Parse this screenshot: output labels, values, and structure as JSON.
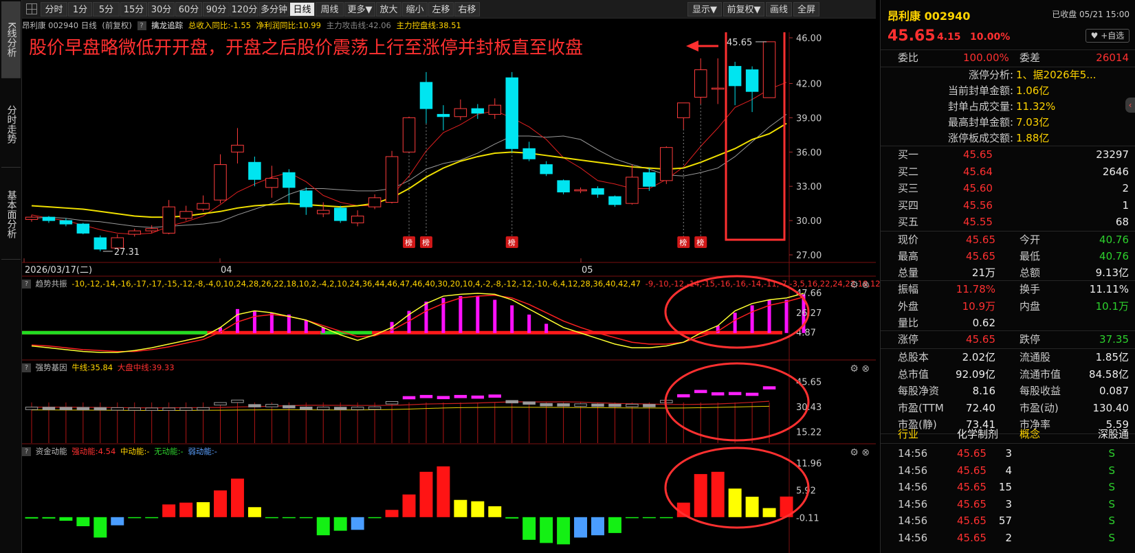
{
  "left_tabs": [
    {
      "label": "K线分析",
      "active": true
    },
    {
      "label": "分时走势",
      "active": false
    },
    {
      "label": "基本面分析",
      "active": false
    }
  ],
  "toolbar": {
    "items": [
      "分时",
      "1分",
      "5分",
      "15分",
      "30分",
      "60分",
      "90分",
      "120分",
      "多分钟",
      "日线",
      "周线",
      "更多▼",
      "放大",
      "缩小",
      "左移",
      "右移"
    ],
    "active": "日线",
    "right_items": [
      "显示▼",
      "前复权▼",
      "画线",
      "全屏"
    ]
  },
  "chart_header": {
    "stock": "昂利康 002940 日线",
    "adjust": "(前复权)",
    "indicator": "擒龙追踪",
    "rev_growth": "总收入同比:-1.55",
    "profit_growth": "净利润同比:10.99",
    "attack_line": "主力攻击线:42.06",
    "control_line": "主力控盘线:38.51"
  },
  "annotation": "股价早盘略微低开开盘，开盘之后股价震荡上行至涨停并封板直至收盘",
  "chart_data": {
    "type": "candlestick",
    "main_y_ticks": [
      "46.00",
      "42.00",
      "39.00",
      "36.00",
      "33.00",
      "30.00",
      "27.00"
    ],
    "x_labels": [
      "2026/03/17(二)",
      "04",
      "05"
    ],
    "low_label": "27.31",
    "high_label": "45.65",
    "bang_label": "榜",
    "candles": [
      {
        "o": 30.1,
        "c": 30.3,
        "h": 30.5,
        "l": 29.9
      },
      {
        "o": 30.3,
        "c": 30.0,
        "h": 30.4,
        "l": 29.8
      },
      {
        "o": 30.0,
        "c": 29.7,
        "h": 30.2,
        "l": 29.5
      },
      {
        "o": 29.7,
        "c": 28.9,
        "h": 29.8,
        "l": 28.8
      },
      {
        "o": 28.5,
        "c": 27.5,
        "h": 28.7,
        "l": 27.31
      },
      {
        "o": 27.6,
        "c": 28.5,
        "h": 28.8,
        "l": 27.5
      },
      {
        "o": 28.8,
        "c": 29.1,
        "h": 29.3,
        "l": 28.6
      },
      {
        "o": 29.1,
        "c": 29.3,
        "h": 29.6,
        "l": 28.9
      },
      {
        "o": 28.9,
        "c": 31.2,
        "h": 31.8,
        "l": 28.8
      },
      {
        "o": 30.2,
        "c": 30.8,
        "h": 31.3,
        "l": 30.0
      },
      {
        "o": 31.0,
        "c": 31.5,
        "h": 32.2,
        "l": 30.8
      },
      {
        "o": 31.8,
        "c": 34.9,
        "h": 35.8,
        "l": 31.5
      },
      {
        "o": 36.0,
        "c": 36.6,
        "h": 38.1,
        "l": 35.0
      },
      {
        "o": 35.1,
        "c": 33.6,
        "h": 35.6,
        "l": 33.0
      },
      {
        "o": 32.9,
        "c": 33.7,
        "h": 34.8,
        "l": 32.0
      },
      {
        "o": 34.2,
        "c": 32.9,
        "h": 34.5,
        "l": 31.5
      },
      {
        "o": 32.6,
        "c": 31.2,
        "h": 32.9,
        "l": 30.5
      },
      {
        "o": 30.6,
        "c": 30.9,
        "h": 31.6,
        "l": 30.3
      },
      {
        "o": 31.1,
        "c": 30.0,
        "h": 31.3,
        "l": 29.8
      },
      {
        "o": 29.8,
        "c": 30.4,
        "h": 30.9,
        "l": 29.5
      },
      {
        "o": 31.2,
        "c": 32.0,
        "h": 32.3,
        "l": 31.0
      },
      {
        "o": 31.6,
        "c": 35.6,
        "h": 36.1,
        "l": 31.5
      },
      {
        "o": 36.0,
        "c": 39.0,
        "h": 39.1,
        "l": 36.0
      },
      {
        "o": 42.1,
        "c": 39.8,
        "h": 43.0,
        "l": 38.5
      },
      {
        "o": 39.3,
        "c": 39.1,
        "h": 40.1,
        "l": 37.9
      },
      {
        "o": 39.1,
        "c": 39.8,
        "h": 40.6,
        "l": 38.8
      },
      {
        "o": 39.8,
        "c": 39.4,
        "h": 40.2,
        "l": 38.9
      },
      {
        "o": 39.3,
        "c": 40.1,
        "h": 40.7,
        "l": 38.9
      },
      {
        "o": 42.5,
        "c": 36.3,
        "h": 43.0,
        "l": 36.0
      },
      {
        "o": 36.3,
        "c": 35.4,
        "h": 36.9,
        "l": 35.2
      },
      {
        "o": 34.9,
        "c": 34.1,
        "h": 35.2,
        "l": 33.9
      },
      {
        "o": 33.5,
        "c": 32.5,
        "h": 33.6,
        "l": 32.3
      },
      {
        "o": 32.6,
        "c": 32.7,
        "h": 32.9,
        "l": 32.4
      },
      {
        "o": 32.8,
        "c": 32.3,
        "h": 33.0,
        "l": 32.0
      },
      {
        "o": 32.1,
        "c": 31.4,
        "h": 32.2,
        "l": 31.2
      },
      {
        "o": 31.5,
        "c": 33.8,
        "h": 34.9,
        "l": 31.4
      },
      {
        "o": 34.2,
        "c": 33.0,
        "h": 34.6,
        "l": 32.6
      },
      {
        "o": 33.5,
        "c": 36.4,
        "h": 36.5,
        "l": 33.2
      },
      {
        "o": 39.0,
        "c": 40.3,
        "h": 40.3,
        "l": 38.0
      },
      {
        "o": 40.8,
        "c": 43.2,
        "h": 44.2,
        "l": 40.2
      },
      {
        "o": 41.5,
        "c": 41.6,
        "h": 44.2,
        "l": 40.2
      },
      {
        "o": 43.5,
        "c": 41.8,
        "h": 43.9,
        "l": 40.1
      },
      {
        "o": 43.2,
        "c": 41.3,
        "h": 43.5,
        "l": 39.5
      },
      {
        "o": 40.76,
        "c": 45.65,
        "h": 45.65,
        "l": 40.76
      }
    ],
    "ma5": [
      30.5,
      30.2,
      30.0,
      29.6,
      29.2,
      28.9,
      28.8,
      28.9,
      29.5,
      29.9,
      30.4,
      31.4,
      32.5,
      33.2,
      33.8,
      34.2,
      33.4,
      32.2,
      31.6,
      31.3,
      31.3,
      32.2,
      33.9,
      36.1,
      37.7,
      38.4,
      39.3,
      39.6,
      39.0,
      38.2,
      37.1,
      35.5,
      34.6,
      33.5,
      33.2,
      32.8,
      32.8,
      33.6,
      34.7,
      36.5,
      38.1,
      39.9,
      40.6,
      41.5,
      42.1
    ],
    "ma10": [
      30.2,
      30.3,
      30.2,
      30.0,
      29.9,
      29.7,
      29.5,
      29.4,
      29.5,
      29.6,
      29.7,
      29.9,
      30.5,
      31.0,
      31.5,
      32.3,
      32.8,
      32.8,
      32.7,
      32.6,
      32.6,
      32.8,
      33.5,
      34.5,
      35.0,
      35.3,
      35.9,
      36.7,
      37.4,
      37.4,
      37.3,
      37.4,
      37.1,
      36.2,
      35.4,
      34.9,
      34.5,
      34.0,
      33.9,
      34.2,
      34.6,
      35.6,
      36.9,
      38.2,
      39.3
    ],
    "ma20": [
      31.3,
      31.2,
      31.1,
      31.0,
      30.8,
      30.6,
      30.4,
      30.3,
      30.3,
      30.4,
      30.6,
      30.8,
      31.1,
      31.3,
      31.4,
      31.5,
      31.4,
      31.3,
      31.2,
      31.3,
      31.5,
      32.0,
      32.8,
      33.8,
      34.6,
      35.2,
      35.6,
      35.9,
      36.0,
      35.9,
      35.7,
      35.5,
      35.3,
      35.1,
      34.9,
      34.7,
      34.6,
      34.5,
      34.6,
      35.1,
      35.7,
      36.3,
      37.1,
      37.6,
      38.5
    ],
    "bang_idx": [
      22,
      23,
      28,
      38,
      39
    ],
    "trend": {
      "title": "趋势共振",
      "out1": [
        -10,
        -12,
        -14,
        -16,
        -17,
        -17,
        -15,
        -12,
        -8,
        -4,
        0,
        10,
        24,
        28,
        26,
        22,
        18,
        10,
        2,
        -4,
        2,
        10,
        24,
        36,
        44,
        46,
        47,
        46,
        40,
        30,
        20,
        10,
        4,
        -2,
        -8,
        -12,
        -12,
        -10,
        -6,
        4,
        12,
        28,
        36,
        40,
        42,
        47
      ],
      "out2": [
        -9,
        -10,
        -12,
        -14,
        -15,
        -16,
        -16,
        -14,
        -11,
        -7,
        -3,
        5,
        16,
        22,
        24,
        22,
        18,
        12,
        6,
        0,
        1,
        7,
        17,
        28,
        36,
        42,
        44,
        45,
        42,
        35,
        26,
        17,
        10,
        4,
        -1,
        -6,
        -8,
        -8,
        -6,
        0,
        6,
        18,
        27,
        34,
        38,
        43
      ],
      "ticks": [
        "47.66",
        "26.27",
        "4.87"
      ],
      "bars": [
        -5,
        -5,
        -5,
        -5,
        -5,
        -5,
        -5,
        -5,
        -5,
        -5,
        -5,
        10,
        30,
        28,
        26,
        24,
        18,
        10,
        -5,
        -5,
        -5,
        16,
        28,
        38,
        42,
        44,
        44,
        40,
        34,
        24,
        14,
        4,
        4,
        4,
        4,
        4,
        4,
        4,
        4,
        4,
        12,
        26,
        34,
        40,
        40,
        46
      ]
    },
    "strong": {
      "title": "强势基因",
      "bull": "牛线:35.84",
      "mid": "大盘中线:39.33",
      "ticks": [
        "45.65",
        "30.43",
        "15.22"
      ]
    },
    "money": {
      "title": "资金动能",
      "strong": "强动能:4.54",
      "mid": "中动能:-",
      "none": "无动能:-",
      "weak": "弱动能:-",
      "ticks": [
        "11.96",
        "5.92",
        "-0.11"
      ],
      "bars": [
        -0.3,
        -0.3,
        -0.8,
        -2.0,
        -4.5,
        -1.8,
        -0.1,
        -0.1,
        2.8,
        3.2,
        3.3,
        5.9,
        8.5,
        2.2,
        -0.2,
        -0.2,
        0.0,
        -4.0,
        -3.0,
        -2.8,
        -0.1,
        1.6,
        5.0,
        10.0,
        11.2,
        3.8,
        3.5,
        2.4,
        -0.3,
        -5.0,
        -5.7,
        -6.0,
        -4.5,
        -4.0,
        -3.5,
        -0.1,
        -0.1,
        -0.1,
        3.2,
        9.5,
        10.0,
        6.3,
        4.5,
        2.0,
        4.54
      ],
      "colors": [
        "g",
        "g",
        "g",
        "g",
        "g",
        "b",
        "g",
        "g",
        "r",
        "r",
        "y",
        "r",
        "r",
        "y",
        "g",
        "g",
        "g",
        "g",
        "g",
        "b",
        "g",
        "r",
        "r",
        "r",
        "r",
        "y",
        "y",
        "y",
        "g",
        "g",
        "g",
        "g",
        "b",
        "b",
        "g",
        "g",
        "g",
        "g",
        "r",
        "r",
        "r",
        "y",
        "y",
        "y",
        "r"
      ]
    }
  },
  "quote": {
    "name": "昂利康 002940",
    "status": "已收盘 05/21 15:00",
    "price": "45.65",
    "change": "4.15",
    "pct": "10.00%",
    "fav": "♥ +自选",
    "webi_label": "委比",
    "webi": "100.00%",
    "weicha_label": "委差",
    "weicha": "26014",
    "limit_analysis": [
      {
        "k": "涨停分析:",
        "v": "1、据2026年5..."
      },
      {
        "k": "当前封单金额:",
        "v": "1.06亿"
      },
      {
        "k": "封单占成交量:",
        "v": "11.32%"
      },
      {
        "k": "最高封单金额:",
        "v": "7.03亿"
      },
      {
        "k": "涨停板成交额:",
        "v": "1.88亿"
      }
    ],
    "buy": [
      {
        "k": "买一",
        "p": "45.65",
        "v": "23297"
      },
      {
        "k": "买二",
        "p": "45.64",
        "v": "2646"
      },
      {
        "k": "买三",
        "p": "45.60",
        "v": "2"
      },
      {
        "k": "买四",
        "p": "45.56",
        "v": "1"
      },
      {
        "k": "买五",
        "p": "45.55",
        "v": "68"
      }
    ],
    "stats1": [
      {
        "k1": "现价",
        "v1": "45.65",
        "c1": "red",
        "k2": "今开",
        "v2": "40.76",
        "c2": "green"
      },
      {
        "k1": "最高",
        "v1": "45.65",
        "c1": "red",
        "k2": "最低",
        "v2": "40.76",
        "c2": "green"
      },
      {
        "k1": "总量",
        "v1": "21万",
        "c1": "white",
        "k2": "总额",
        "v2": "9.13亿",
        "c2": "white"
      }
    ],
    "stats2": [
      {
        "k1": "振幅",
        "v1": "11.78%",
        "c1": "red",
        "k2": "换手",
        "v2": "11.11%",
        "c2": "white"
      },
      {
        "k1": "外盘",
        "v1": "10.9万",
        "c1": "red",
        "k2": "内盘",
        "v2": "10.1万",
        "c2": "green"
      },
      {
        "k1": "量比",
        "v1": "0.62",
        "c1": "white",
        "k2": "",
        "v2": "",
        "c2": "white"
      }
    ],
    "stats3": [
      {
        "k1": "涨停",
        "v1": "45.65",
        "c1": "red",
        "k2": "跌停",
        "v2": "37.35",
        "c2": "green"
      }
    ],
    "stats4": [
      {
        "k1": "总股本",
        "v1": "2.02亿",
        "k2": "流通股",
        "v2": "1.85亿"
      },
      {
        "k1": "总市值",
        "v1": "92.09亿",
        "k2": "流通市值",
        "v2": "84.58亿"
      },
      {
        "k1": "每股净资",
        "v1": "8.16",
        "k2": "每股收益",
        "v2": "0.087"
      },
      {
        "k1": "市盈(TTM",
        "v1": "72.40",
        "k2": "市盈(动)",
        "v2": "130.40"
      },
      {
        "k1": "市盈(静)",
        "v1": "73.41",
        "k2": "市净率",
        "v2": "5.59"
      }
    ],
    "industry": {
      "k1": "行业",
      "v1": "化学制剂",
      "k2": "概念",
      "v2": "深股通"
    },
    "ticks": [
      {
        "t": "14:56",
        "p": "45.65",
        "v": "3",
        "s": "S"
      },
      {
        "t": "14:56",
        "p": "45.65",
        "v": "4",
        "s": "S"
      },
      {
        "t": "14:56",
        "p": "45.65",
        "v": "15",
        "s": "S"
      },
      {
        "t": "14:56",
        "p": "45.65",
        "v": "3",
        "s": "S"
      },
      {
        "t": "14:56",
        "p": "45.65",
        "v": "57",
        "s": "S"
      },
      {
        "t": "14:56",
        "p": "45.65",
        "v": "2",
        "s": "S"
      }
    ]
  }
}
